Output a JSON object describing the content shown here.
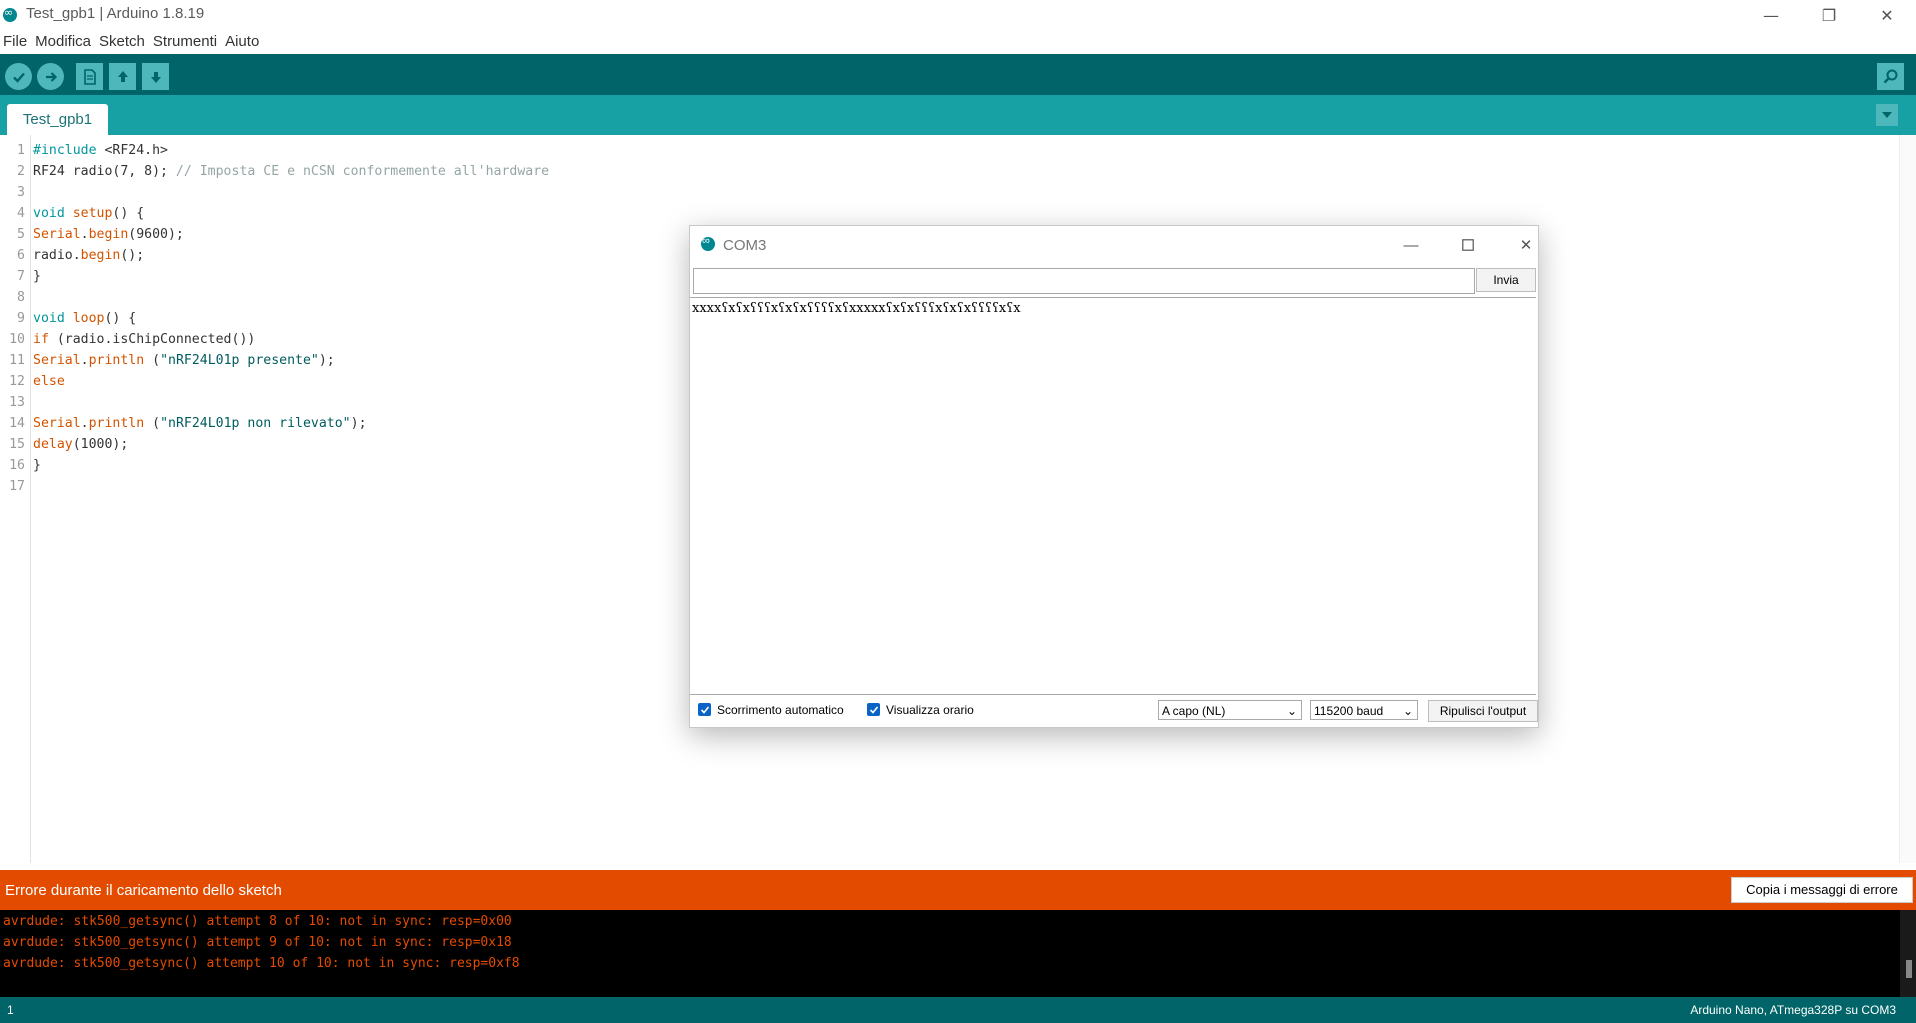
{
  "window": {
    "title": "Test_gpb1 | Arduino 1.8.19",
    "controls": {
      "minimize": "—",
      "restore": "❐",
      "close": "✕"
    }
  },
  "menu": [
    "File",
    "Modifica",
    "Sketch",
    "Strumenti",
    "Aiuto"
  ],
  "toolbar": {
    "buttons": [
      "verify-icon",
      "upload-icon",
      "new-icon",
      "open-icon",
      "save-icon"
    ],
    "serial_monitor_icon": "magnifier-icon"
  },
  "tabs": [
    {
      "label": "Test_gpb1"
    }
  ],
  "editor": {
    "line_numbers": [
      "1",
      "2",
      "3",
      "4",
      "5",
      "6",
      "7",
      "8",
      "9",
      "10",
      "11",
      "12",
      "13",
      "14",
      "15",
      "16",
      "17"
    ],
    "lines": [
      [
        {
          "t": "#include",
          "c": "kw"
        },
        {
          "t": " <RF24.h>",
          "c": ""
        }
      ],
      [
        {
          "t": "RF24 radio(7, 8); ",
          "c": ""
        },
        {
          "t": "// Imposta CE e nCSN conformemente all'hardware",
          "c": "cm"
        }
      ],
      [],
      [
        {
          "t": "void",
          "c": "kw"
        },
        {
          "t": " ",
          "c": ""
        },
        {
          "t": "setup",
          "c": "fn"
        },
        {
          "t": "() {",
          "c": ""
        }
      ],
      [
        {
          "t": "Serial",
          "c": "fn"
        },
        {
          "t": ".",
          "c": ""
        },
        {
          "t": "begin",
          "c": "fn"
        },
        {
          "t": "(9600);",
          "c": ""
        }
      ],
      [
        {
          "t": "radio.",
          "c": ""
        },
        {
          "t": "begin",
          "c": "fn"
        },
        {
          "t": "();",
          "c": ""
        }
      ],
      [
        {
          "t": "}",
          "c": ""
        }
      ],
      [],
      [
        {
          "t": "void",
          "c": "kw"
        },
        {
          "t": " ",
          "c": ""
        },
        {
          "t": "loop",
          "c": "fn"
        },
        {
          "t": "() {",
          "c": ""
        }
      ],
      [
        {
          "t": "if",
          "c": "fn"
        },
        {
          "t": " (radio.isChipConnected())",
          "c": ""
        }
      ],
      [
        {
          "t": "Serial",
          "c": "fn"
        },
        {
          "t": ".",
          "c": ""
        },
        {
          "t": "println",
          "c": "fn"
        },
        {
          "t": " (",
          "c": ""
        },
        {
          "t": "\"nRF24L01p presente\"",
          "c": "st"
        },
        {
          "t": ");",
          "c": ""
        }
      ],
      [
        {
          "t": "else",
          "c": "fn"
        }
      ],
      [],
      [
        {
          "t": "Serial",
          "c": "fn"
        },
        {
          "t": ".",
          "c": ""
        },
        {
          "t": "println",
          "c": "fn"
        },
        {
          "t": " (",
          "c": ""
        },
        {
          "t": "\"nRF24L01p non rilevato\"",
          "c": "st"
        },
        {
          "t": ");",
          "c": ""
        }
      ],
      [
        {
          "t": "delay",
          "c": "fn"
        },
        {
          "t": "(1000);",
          "c": ""
        }
      ],
      [
        {
          "t": "}",
          "c": ""
        }
      ],
      []
    ]
  },
  "error": {
    "message": "Errore durante il caricamento dello sketch",
    "copy_button": "Copia i messaggi di errore"
  },
  "console": {
    "lines": [
      "avrdude: stk500_getsync() attempt 8 of 10: not in sync: resp=0x00",
      "avrdude: stk500_getsync() attempt 9 of 10: not in sync: resp=0x18",
      "avrdude: stk500_getsync() attempt 10 of 10: not in sync: resp=0xf8"
    ]
  },
  "status": {
    "line": "1",
    "board": "Arduino Nano, ATmega328P su COM3"
  },
  "serial_monitor": {
    "title": "COM3",
    "input_value": "",
    "send_button": "Invia",
    "output": "xxxxʕxʕxʕʕʕxʕxʕxʕʕʕʕxʕxxxxxʕxʕxʕʕʕxʕxʕxʕʕʕʕxʕx",
    "autoscroll": {
      "label": "Scorrimento automatico",
      "checked": true
    },
    "timestamp": {
      "label": "Visualizza orario",
      "checked": true
    },
    "line_ending": "A capo (NL)",
    "baud": "115200 baud",
    "clear_button": "Ripulisci l'output"
  },
  "colors": {
    "toolbar": "#006468",
    "tabbar": "#17a1a5",
    "error": "#e34c00",
    "keyword": "#00979c",
    "function": "#d35400"
  }
}
